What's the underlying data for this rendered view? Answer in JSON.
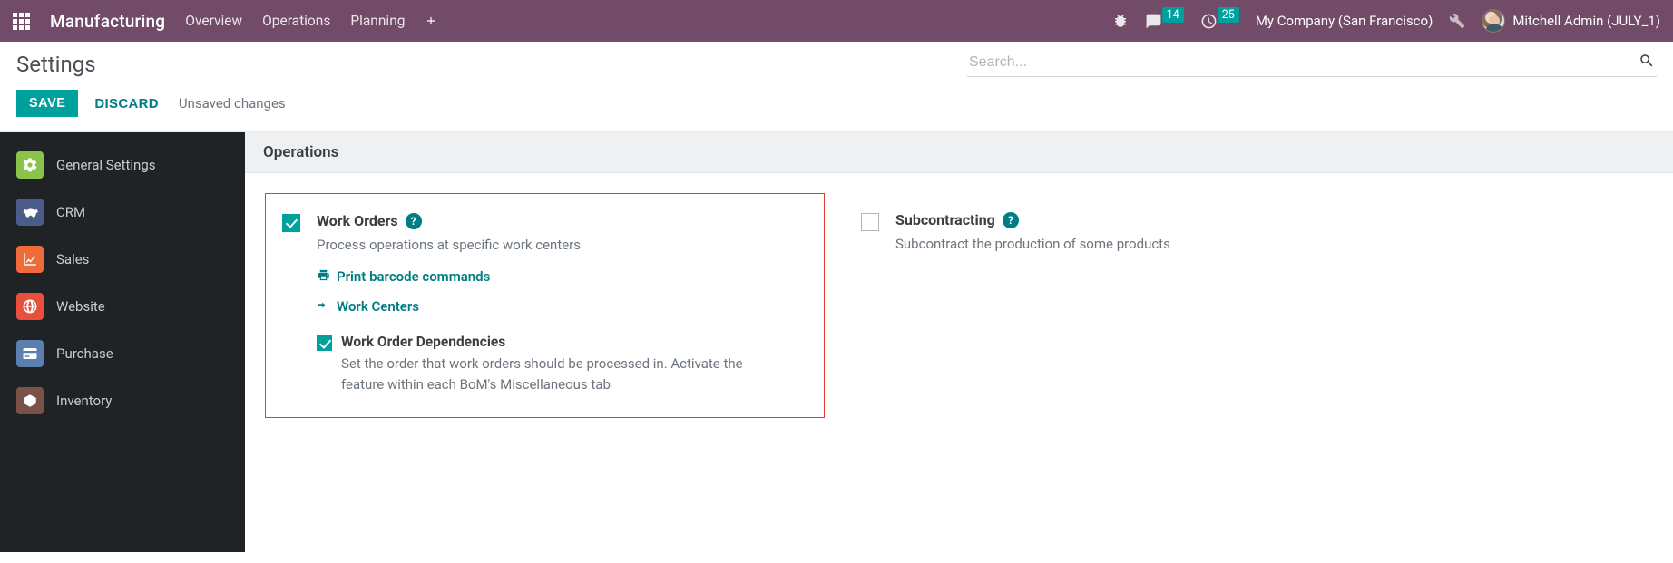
{
  "topnav": {
    "app_title": "Manufacturing",
    "links": [
      "Overview",
      "Operations",
      "Planning"
    ],
    "chat_badge": "14",
    "clock_badge": "25",
    "company": "My Company (San Francisco)",
    "user": "Mitchell Admin (JULY_1)"
  },
  "header": {
    "title": "Settings",
    "search_placeholder": "Search..."
  },
  "actions": {
    "save": "SAVE",
    "discard": "DISCARD",
    "dirty": "Unsaved changes"
  },
  "sidebar": {
    "items": [
      {
        "label": "General Settings"
      },
      {
        "label": "CRM"
      },
      {
        "label": "Sales"
      },
      {
        "label": "Website"
      },
      {
        "label": "Purchase"
      },
      {
        "label": "Inventory"
      }
    ]
  },
  "section": {
    "title": "Operations",
    "work_orders": {
      "title": "Work Orders",
      "desc": "Process operations at specific work centers",
      "links": {
        "print": "Print barcode commands",
        "centers": "Work Centers"
      },
      "dependencies": {
        "title": "Work Order Dependencies",
        "desc": "Set the order that work orders should be processed in. Activate the feature within each BoM's Miscellaneous tab"
      }
    },
    "subcontracting": {
      "title": "Subcontracting",
      "desc": "Subcontract the production of some products"
    }
  }
}
